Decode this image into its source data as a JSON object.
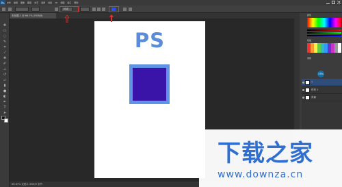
{
  "app": {
    "logo": "Ps"
  },
  "menu": {
    "items": [
      "",
      "",
      "",
      "",
      "",
      "",
      "",
      "",
      "",
      "",
      ""
    ]
  },
  "options": {
    "font_size_value": "18点",
    "icons": [
      "move-icon",
      "font-size-icon",
      "color-swatch-icon"
    ],
    "swatch_color": "#2a4dff"
  },
  "tabs": [
    {
      "label": "未标题-1 @ 66.7% (RGB/8)"
    }
  ],
  "canvas": {
    "doc_text": "PS",
    "text_color": "#5b8bd9",
    "square_fill": "#3a14a8",
    "square_stroke": "#5f93e6"
  },
  "status": {
    "text": "66.67%  文档:1.55M/0 字节"
  },
  "layers": {
    "badge": "53%",
    "rows": [
      {
        "label": "T",
        "selected": true
      },
      {
        "label": "形状 1",
        "selected": false
      },
      {
        "label": "背景",
        "selected": false
      }
    ]
  },
  "watermark": {
    "title": "下载之家",
    "url": "www.downza.cn"
  }
}
